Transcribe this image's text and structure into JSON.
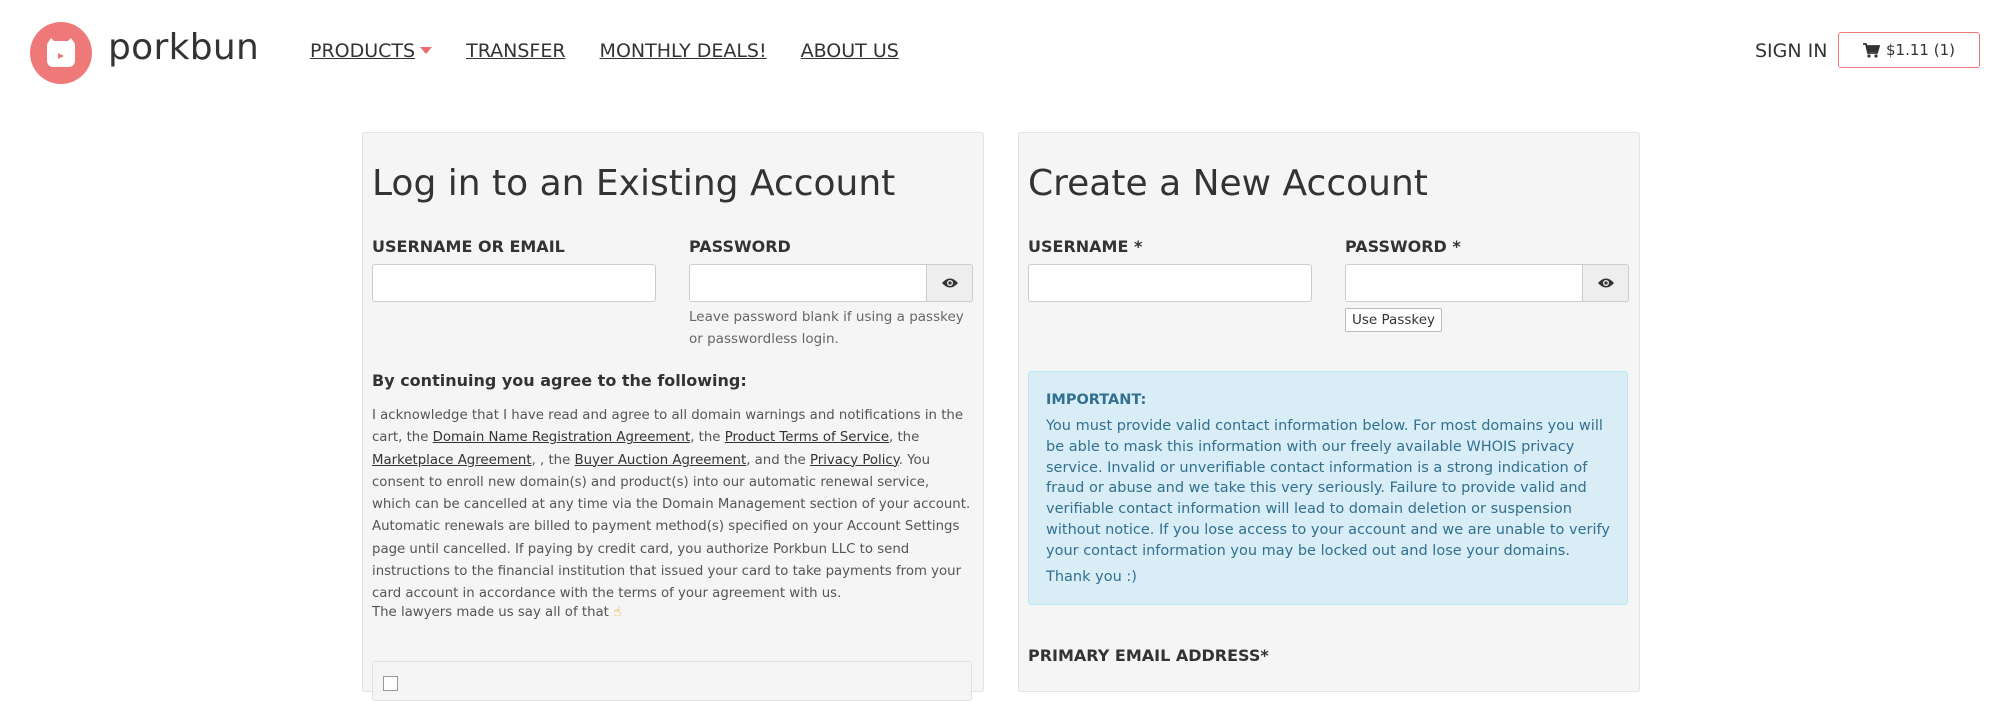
{
  "brand": {
    "name": "porkbun",
    "logo_color": "#ef7878"
  },
  "nav": {
    "products": "PRODUCTS",
    "transfer": "TRANSFER",
    "monthly_deals": "MONTHLY DEALS!",
    "about_us": "ABOUT US",
    "sign_in": "SIGN IN",
    "cart": "$1.11 (1)"
  },
  "login": {
    "title": "Log in to an Existing Account",
    "username_label": "USERNAME OR EMAIL",
    "username_value": "",
    "password_label": "PASSWORD",
    "password_value": "",
    "password_hint": "Leave password blank if using a passkey or passwordless login.",
    "agree_heading": "By continuing you agree to the following:",
    "legal": {
      "p1": "I acknowledge that I have read and agree to all domain warnings and notifications in the cart, the ",
      "link_dnra": "Domain Name Registration Agreement",
      "p2": ", the ",
      "link_pts": "Product Terms of Service",
      "p3": ", the ",
      "link_ma": "Marketplace Agreement",
      "p4": ", , the ",
      "link_baa": "Buyer Auction Agreement",
      "p5": ", and the ",
      "link_pp": "Privacy Policy",
      "p6": ". You consent to enroll new domain(s) and product(s) into our automatic renewal service, which can be cancelled at any time via the Domain Management section of your account. Automatic renewals are billed to payment method(s) specified on your Account Settings page until cancelled. If paying by credit card, you authorize Porkbun LLC to send instructions to the financial institution that issued your card to take payments from your card account in accordance with the terms of your agreement with us."
    },
    "lawyers_note": "The lawyers made us say all of that"
  },
  "signup": {
    "title": "Create a New Account",
    "username_label": "USERNAME *",
    "username_value": "",
    "password_label": "PASSWORD *",
    "password_value": "",
    "passkey_button": "Use Passkey",
    "alert": {
      "heading": "IMPORTANT:",
      "body": "You must provide valid contact information below. For most domains you will be able to mask this information with our freely available WHOIS privacy service. Invalid or unverifiable contact information is a strong indication of fraud or abuse and we take this very seriously. Failure to provide valid and verifiable contact information will lead to domain deletion or suspension without notice. If you lose access to your account and we are unable to verify your contact information you may be locked out and lose your domains.",
      "thanks": "Thank you :)"
    },
    "email_label": "PRIMARY EMAIL ADDRESS*"
  },
  "colors": {
    "accent": "#ef7878",
    "alert_bg": "#d9edf7",
    "alert_text": "#31708f",
    "panel_bg": "#f5f5f5"
  },
  "icons": {
    "eye": "eye-icon",
    "cart": "cart-icon",
    "caret": "caret-down-icon",
    "hand": "pointing-hand-icon"
  }
}
